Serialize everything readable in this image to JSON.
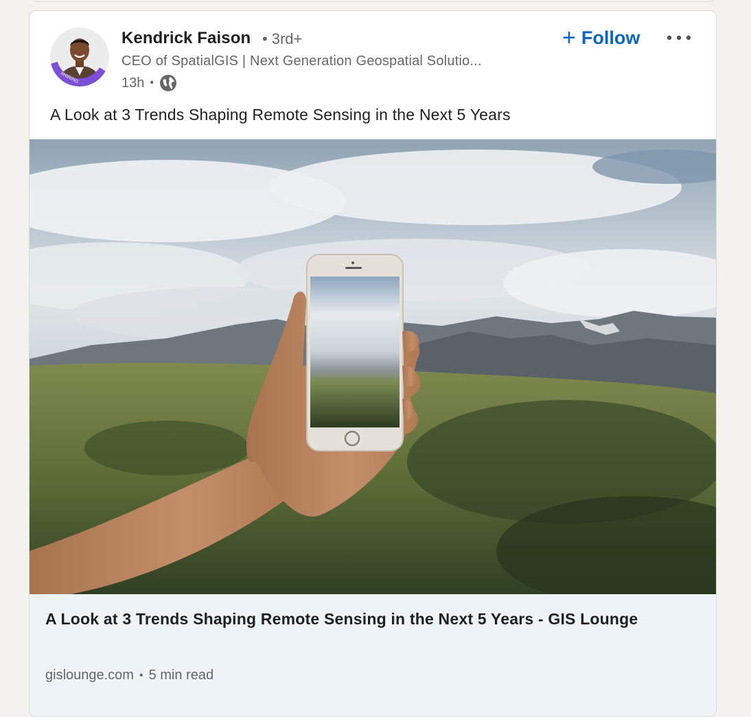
{
  "post": {
    "author": {
      "name": "Kendrick Faison",
      "degree": "3rd+",
      "headline": "CEO of SpatialGIS | Next Generation Geospatial Solutio...",
      "badge": "#HIRING"
    },
    "time": "13h",
    "visibility_icon": "globe-icon",
    "follow_label": "Follow",
    "more_icon": "ellipsis-icon",
    "text": "A Look at 3 Trends Shaping Remote Sensing in the Next 5 Years",
    "image_alt": "Hand holding a smartphone in front of a mountain landscape",
    "link": {
      "title": "A Look at 3 Trends Shaping Remote Sensing in the Next 5 Years - GIS Lounge",
      "domain": "gislounge.com",
      "read_time": "5 min read"
    }
  },
  "colors": {
    "accent": "#0a66c2",
    "hiring_ring": "#7b4fd6",
    "link_bg": "#eef3f8",
    "page_bg": "#f4f2ee"
  }
}
